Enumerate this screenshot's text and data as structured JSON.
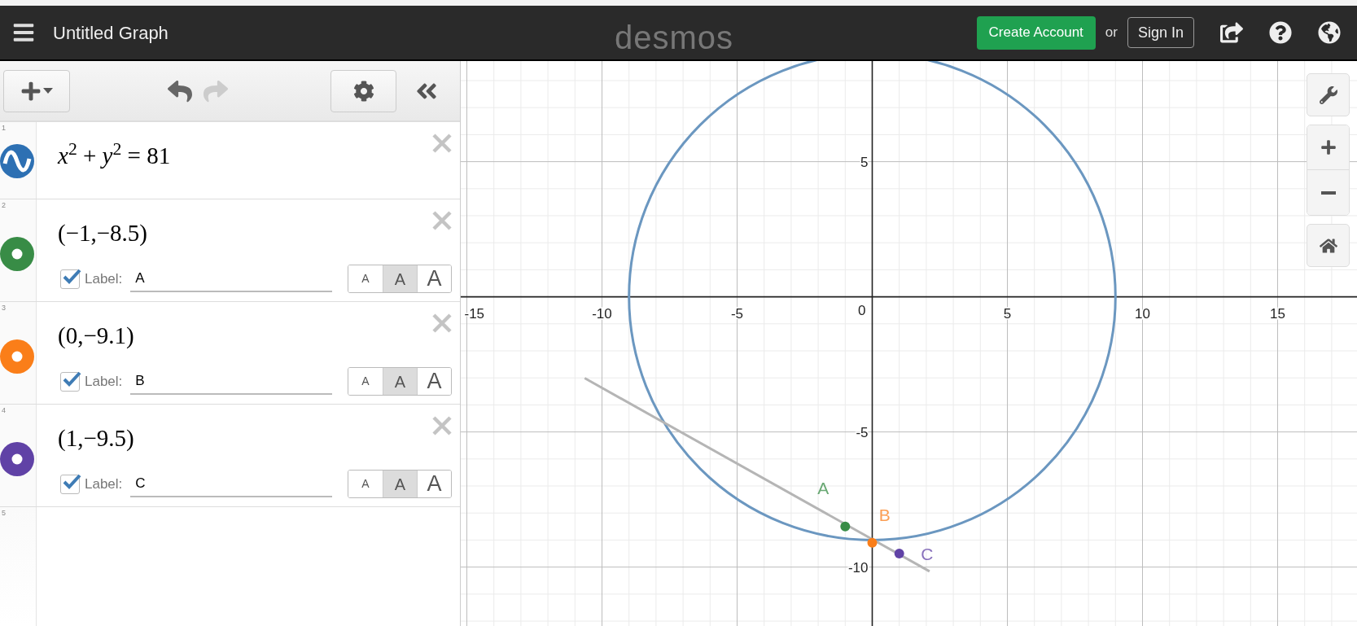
{
  "header": {
    "title": "Untitled Graph",
    "logo": "desmos",
    "create_account": "Create Account",
    "or": "or",
    "sign_in": "Sign In"
  },
  "expressions": [
    {
      "number": "1",
      "kind": "curve",
      "color": "#2d70b3",
      "latex": "*x*$^{2}$ + *y*$^{2}$ = 81"
    },
    {
      "number": "2",
      "kind": "point",
      "color": "#388c46",
      "latex": "(−1,−8.5)",
      "label_checked": true,
      "label_caption": "Label:",
      "label": "A",
      "sizes": [
        {
          "text": "A",
          "selected": false
        },
        {
          "text": "A",
          "selected": true
        },
        {
          "text": "A",
          "selected": false
        }
      ]
    },
    {
      "number": "3",
      "kind": "point",
      "color": "#fa7e19",
      "latex": "(0,−9.1)",
      "label_checked": true,
      "label_caption": "Label:",
      "label": "B",
      "sizes": [
        {
          "text": "A",
          "selected": false
        },
        {
          "text": "A",
          "selected": true
        },
        {
          "text": "A",
          "selected": false
        }
      ]
    },
    {
      "number": "4",
      "kind": "point",
      "color": "#6042a6",
      "latex": "(1,−9.5)",
      "label_checked": true,
      "label_caption": "Label:",
      "label": "C",
      "sizes": [
        {
          "text": "A",
          "selected": false
        },
        {
          "text": "A",
          "selected": true
        },
        {
          "text": "A",
          "selected": false
        }
      ]
    }
  ],
  "empty_row": {
    "number": "5"
  },
  "graph": {
    "x_ticks": [
      "-15",
      "-10",
      "-5",
      "5",
      "10",
      "15"
    ],
    "y_ticks": [
      "5",
      "-5",
      "-10"
    ],
    "origin": "0",
    "points": [
      {
        "label": "A",
        "color": "#388c46"
      },
      {
        "label": "B",
        "color": "#fa7e19"
      },
      {
        "label": "C",
        "color": "#6042a6"
      }
    ]
  }
}
